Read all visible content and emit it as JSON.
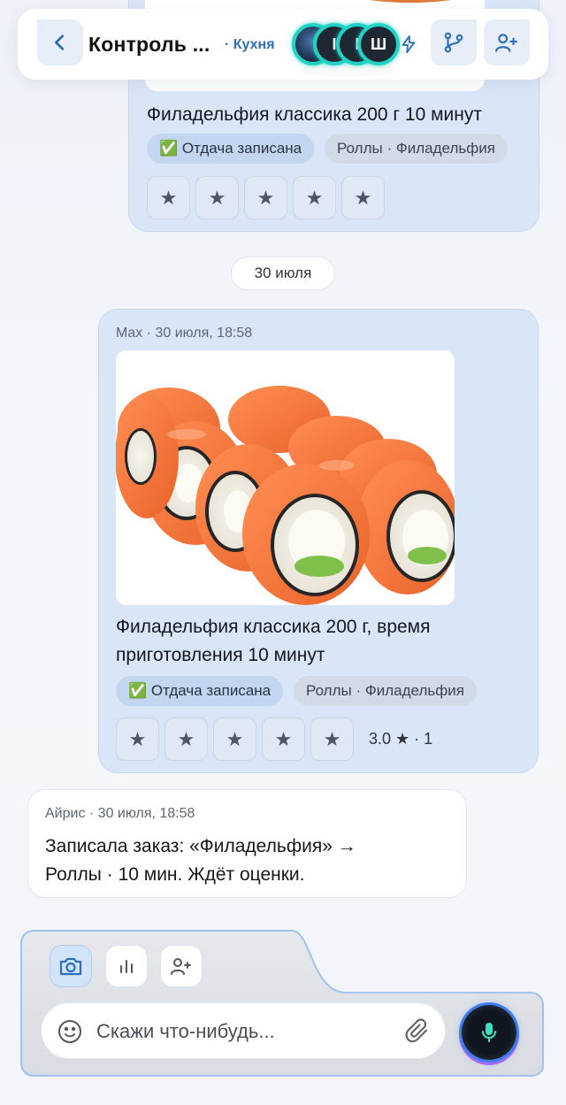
{
  "header": {
    "title": "Контроль ...",
    "subtitle": "· Кухня",
    "avatars": [
      {
        "letter": ""
      },
      {
        "letter": "I"
      },
      {
        "letter": "I"
      },
      {
        "letter": "Ш"
      }
    ]
  },
  "messages": {
    "top_card": {
      "title": "Филадельфия классика 200 г 10 минут",
      "status_chip": "✅ Отдача записана",
      "category_chip": "Роллы · Филадельфия",
      "stars": [
        "★",
        "★",
        "★",
        "★",
        "★"
      ]
    },
    "date_separator": "30 июля",
    "mid_card": {
      "meta": "Max · 30 июля, 18:58",
      "title_line1": "Филадельфия классика 200 г, время",
      "title_line2": "приготовления 10 минут",
      "status_chip": "✅ Отдача записана",
      "category_chip": "Роллы · Филадельфия",
      "stars": [
        "★",
        "★",
        "★",
        "★",
        "★"
      ],
      "rating": "3.0 ★ · 1"
    },
    "reply": {
      "meta": "Айрис · 30 июля, 18:58",
      "text_line1": "Записала заказ: «Филадельфия» →",
      "text_line2": "Роллы · 10 мин. Ждёт оценки."
    }
  },
  "composer": {
    "placeholder": "Скажи что-нибудь..."
  },
  "colors": {
    "accent": "#2d6fb8",
    "card_bg": "#d9e6f7",
    "avatar_ring": "#22d3c5",
    "mic_ring": "#3c7df2"
  }
}
